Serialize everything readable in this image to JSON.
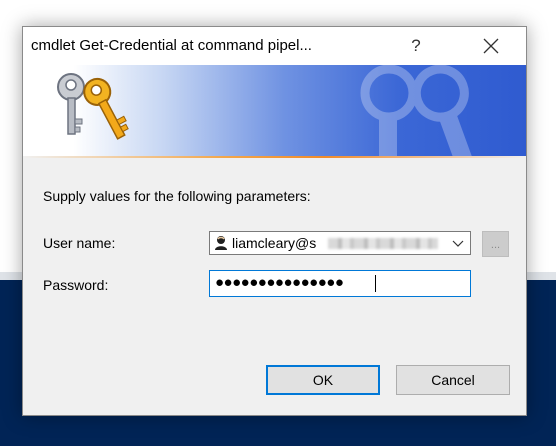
{
  "dialog": {
    "title": "cmdlet Get-Credential at command pipel...",
    "help_glyph": "?",
    "close_icon": "close-icon",
    "prompt": "Supply values for the following parameters:",
    "username": {
      "label": "User name:",
      "value": "liamcleary@s",
      "browse_label": "..."
    },
    "password": {
      "label": "Password:",
      "masked_value": "●●●●●●●●●●●●●●●"
    },
    "buttons": {
      "ok": "OK",
      "cancel": "Cancel"
    }
  },
  "colors": {
    "focus_blue": "#0078d7",
    "console_background": "#012456",
    "banner_blue": "#2f5bd0",
    "banner_orange": "#f08b2a"
  }
}
